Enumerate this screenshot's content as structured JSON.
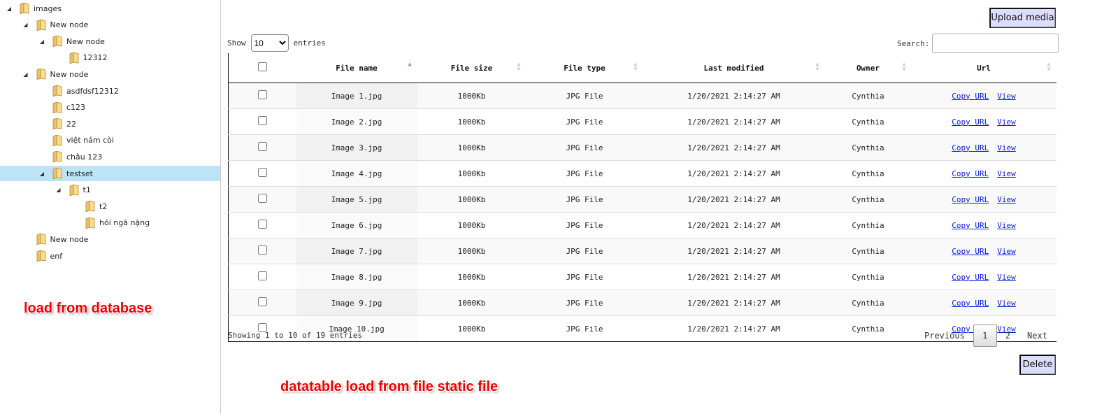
{
  "tree": [
    {
      "label": "images",
      "expanded": true,
      "level": 0
    },
    {
      "label": "New node",
      "expanded": true,
      "level": 1
    },
    {
      "label": "New node",
      "expanded": true,
      "level": 2
    },
    {
      "label": "12312",
      "expanded": null,
      "level": 3
    },
    {
      "label": "New node",
      "expanded": true,
      "level": 1
    },
    {
      "label": "asdfdsf12312",
      "expanded": null,
      "level": 2
    },
    {
      "label": "c123",
      "expanded": null,
      "level": 2
    },
    {
      "label": "22",
      "expanded": null,
      "level": 2
    },
    {
      "label": "việt nám còi",
      "expanded": null,
      "level": 2
    },
    {
      "label": "châu 123",
      "expanded": null,
      "level": 2
    },
    {
      "label": "testset",
      "expanded": true,
      "level": 2,
      "selected": true
    },
    {
      "label": "t1",
      "expanded": true,
      "level": 3
    },
    {
      "label": "t2",
      "expanded": null,
      "level": 4
    },
    {
      "label": "hỏi ngã nặng",
      "expanded": null,
      "level": 4
    },
    {
      "label": "New node",
      "expanded": null,
      "level": 1
    },
    {
      "label": "enf",
      "expanded": null,
      "level": 1
    }
  ],
  "annotations": {
    "left": "load from database",
    "bottom": "datatable load from file static file"
  },
  "toolbar": {
    "upload_label": "Upload media",
    "delete_label": "Delete"
  },
  "length": {
    "show_label": "Show",
    "value": "10",
    "entries_label": "entries"
  },
  "search": {
    "label": "Search:",
    "value": ""
  },
  "table": {
    "columns": [
      "File name",
      "File size",
      "File type",
      "Last modified",
      "Owner",
      "Url"
    ],
    "rows": [
      {
        "name": "Image 1.jpg",
        "size": "1000Kb",
        "type": "JPG File",
        "modified": "1/20/2021 2:14:27 AM",
        "owner": "Cynthia"
      },
      {
        "name": "Image 2.jpg",
        "size": "1000Kb",
        "type": "JPG File",
        "modified": "1/20/2021 2:14:27 AM",
        "owner": "Cynthia"
      },
      {
        "name": "Image 3.jpg",
        "size": "1000Kb",
        "type": "JPG File",
        "modified": "1/20/2021 2:14:27 AM",
        "owner": "Cynthia"
      },
      {
        "name": "Image 4.jpg",
        "size": "1000Kb",
        "type": "JPG File",
        "modified": "1/20/2021 2:14:27 AM",
        "owner": "Cynthia"
      },
      {
        "name": "Image 5.jpg",
        "size": "1000Kb",
        "type": "JPG File",
        "modified": "1/20/2021 2:14:27 AM",
        "owner": "Cynthia"
      },
      {
        "name": "Image 6.jpg",
        "size": "1000Kb",
        "type": "JPG File",
        "modified": "1/20/2021 2:14:27 AM",
        "owner": "Cynthia"
      },
      {
        "name": "Image 7.jpg",
        "size": "1000Kb",
        "type": "JPG File",
        "modified": "1/20/2021 2:14:27 AM",
        "owner": "Cynthia"
      },
      {
        "name": "Image 8.jpg",
        "size": "1000Kb",
        "type": "JPG File",
        "modified": "1/20/2021 2:14:27 AM",
        "owner": "Cynthia"
      },
      {
        "name": "Image 9.jpg",
        "size": "1000Kb",
        "type": "JPG File",
        "modified": "1/20/2021 2:14:27 AM",
        "owner": "Cynthia"
      },
      {
        "name": "Image 10.jpg",
        "size": "1000Kb",
        "type": "JPG File",
        "modified": "1/20/2021 2:14:27 AM",
        "owner": "Cynthia"
      }
    ],
    "copy_url_label": "Copy URL",
    "view_label": "View"
  },
  "info": "Showing 1 to 10 of 19 entries",
  "pager": {
    "previous": "Previous",
    "pages": [
      "1",
      "2"
    ],
    "current": "1",
    "next": "Next"
  },
  "colors": {
    "selected_bg": "#bde4f6",
    "button_bg": "#dcdcfc",
    "link": "#0a1ad9",
    "annotation": "#ee0000"
  }
}
